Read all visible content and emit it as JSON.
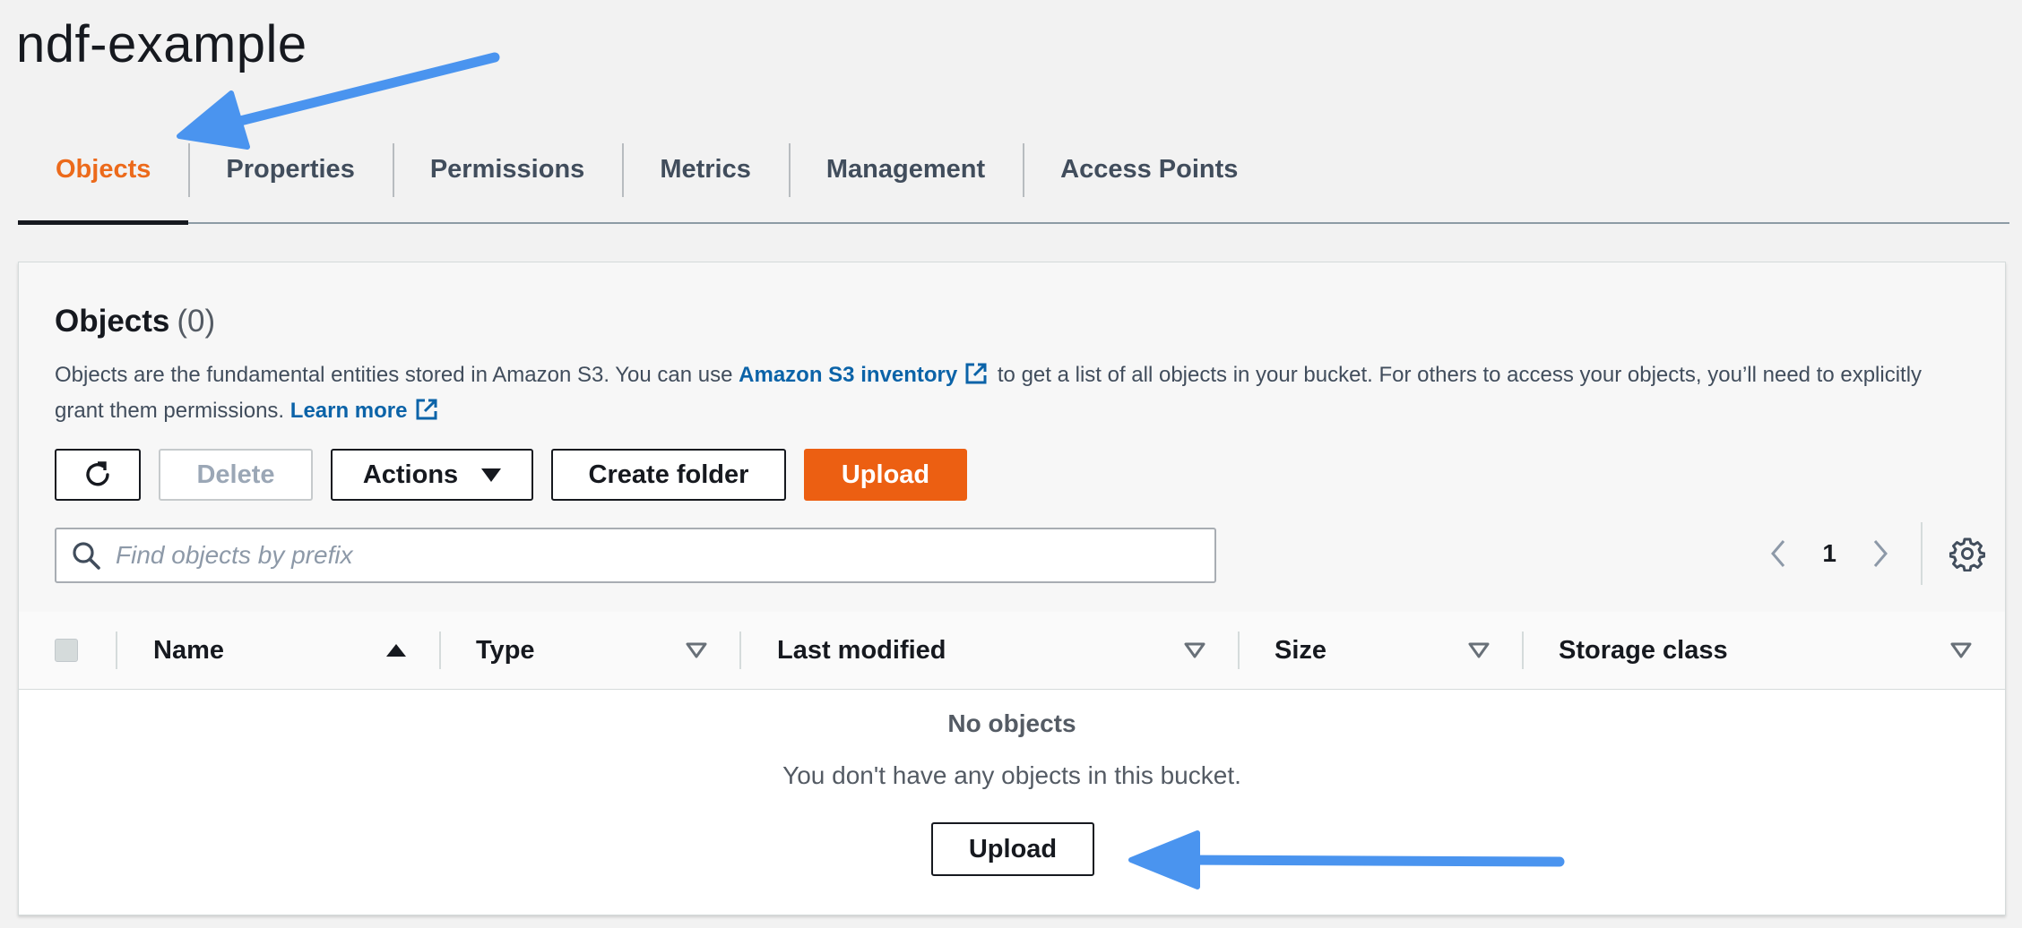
{
  "bucket": {
    "name": "ndf-example"
  },
  "tabs": [
    {
      "label": "Objects",
      "active": true
    },
    {
      "label": "Properties",
      "active": false
    },
    {
      "label": "Permissions",
      "active": false
    },
    {
      "label": "Metrics",
      "active": false
    },
    {
      "label": "Management",
      "active": false
    },
    {
      "label": "Access Points",
      "active": false
    }
  ],
  "objects_panel": {
    "title": "Objects",
    "count": "(0)",
    "description": {
      "part1": "Objects are the fundamental entities stored in Amazon S3. You can use ",
      "inventory_link": "Amazon S3 inventory",
      "part2": " to get a list of all objects in your bucket. For others to access your objects, you’ll need to explicitly grant them permissions. ",
      "learn_more_link": "Learn more"
    },
    "toolbar": {
      "refresh_icon": "refresh-icon",
      "delete_label": "Delete",
      "actions_label": "Actions",
      "create_folder_label": "Create folder",
      "upload_label": "Upload"
    },
    "search": {
      "placeholder": "Find objects by prefix",
      "value": ""
    },
    "pagination": {
      "current_page": "1"
    },
    "table": {
      "columns": [
        {
          "label": "Name",
          "sort": "ascending"
        },
        {
          "label": "Type",
          "sort": "none"
        },
        {
          "label": "Last modified",
          "sort": "none"
        },
        {
          "label": "Size",
          "sort": "none"
        },
        {
          "label": "Storage class",
          "sort": "none"
        }
      ],
      "rows": []
    },
    "empty_state": {
      "title": "No objects",
      "message": "You don't have any objects in this bucket.",
      "upload_label": "Upload"
    }
  },
  "colors": {
    "accent": "#ec6a1b",
    "primary_button": "#ec5f12",
    "link": "#0b63a8",
    "annotation_arrow": "#4a94ef"
  }
}
